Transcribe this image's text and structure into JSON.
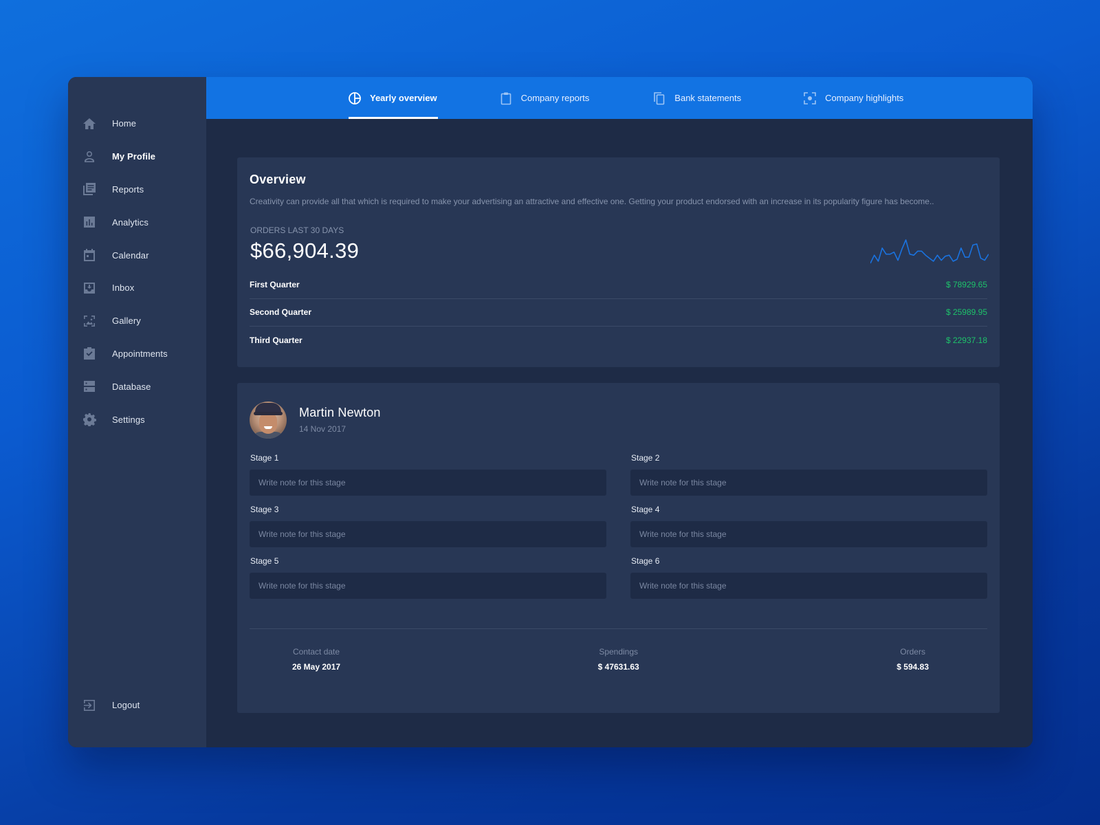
{
  "sidebar": {
    "items": [
      {
        "label": "Home",
        "icon": "home-icon"
      },
      {
        "label": "My Profile",
        "icon": "user-icon",
        "active": true
      },
      {
        "label": "Reports",
        "icon": "reports-icon"
      },
      {
        "label": "Analytics",
        "icon": "analytics-icon"
      },
      {
        "label": "Calendar",
        "icon": "calendar-icon"
      },
      {
        "label": "Inbox",
        "icon": "inbox-icon"
      },
      {
        "label": "Gallery",
        "icon": "gallery-icon"
      },
      {
        "label": "Appointments",
        "icon": "clipboard-check-icon"
      },
      {
        "label": "Database",
        "icon": "database-icon"
      },
      {
        "label": "Settings",
        "icon": "gear-icon"
      }
    ],
    "logout": {
      "label": "Logout",
      "icon": "logout-icon"
    }
  },
  "tabs": [
    {
      "label": "Yearly overview",
      "icon": "pie-chart-icon",
      "active": true
    },
    {
      "label": "Company reports",
      "icon": "clipboard-icon"
    },
    {
      "label": "Bank statements",
      "icon": "copy-icon"
    },
    {
      "label": "Company highlights",
      "icon": "focus-icon"
    }
  ],
  "colors": {
    "accent": "#1273e3",
    "positive": "#1ec26a",
    "sidebar": "#283755",
    "content": "#1e2b46",
    "card": "#283755"
  },
  "overview": {
    "title": "Overview",
    "description": "Creativity can provide all that which is required to make your advertising an attractive and effective one. Getting your product endorsed with an increase in its popularity figure has become..",
    "orders_label": "ORDERS LAST 30 DAYS",
    "orders_value": "$66,904.39",
    "sparkline": [
      3,
      11,
      5,
      18,
      12,
      12,
      14,
      6,
      17,
      26,
      12,
      11,
      15,
      15,
      11,
      8,
      5,
      11,
      6,
      10,
      11,
      5,
      7,
      18,
      9,
      9,
      21,
      22,
      8,
      6,
      12
    ],
    "quarters": [
      {
        "label": "First Quarter",
        "value": "$ 78929.65"
      },
      {
        "label": "Second Quarter",
        "value": "$ 25989.95"
      },
      {
        "label": "Third Quarter",
        "value": "$ 22937.18"
      }
    ]
  },
  "profile": {
    "name": "Martin Newton",
    "date": "14 Nov 2017",
    "stages": [
      {
        "label": "Stage 1",
        "placeholder": "Write note for this stage",
        "value": ""
      },
      {
        "label": "Stage 2",
        "placeholder": "Write note for this stage",
        "value": ""
      },
      {
        "label": "Stage 3",
        "placeholder": "Write note for this stage",
        "value": ""
      },
      {
        "label": "Stage 4",
        "placeholder": "Write note for this stage",
        "value": ""
      },
      {
        "label": "Stage 5",
        "placeholder": "Write note for this stage",
        "value": ""
      },
      {
        "label": "Stage 6",
        "placeholder": "Write note for this stage",
        "value": ""
      }
    ],
    "stats": [
      {
        "label": "Contact date",
        "value": "26 May 2017"
      },
      {
        "label": "Spendings",
        "value": "$ 47631.63"
      },
      {
        "label": "Orders",
        "value": "$ 594.83"
      }
    ]
  }
}
